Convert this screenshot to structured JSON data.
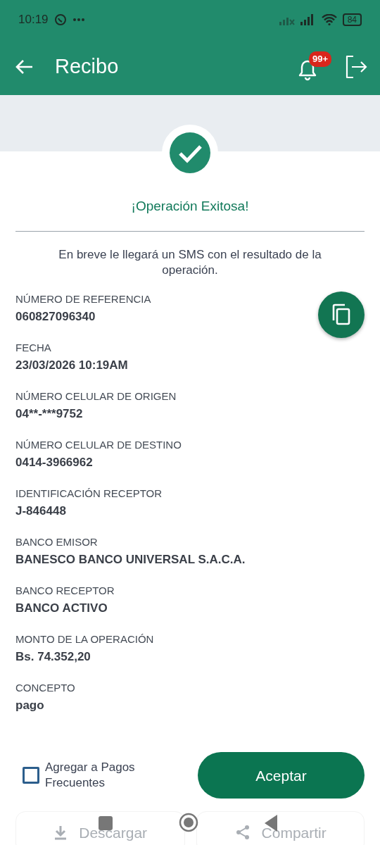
{
  "status_bar": {
    "time": "10:19",
    "battery": "84"
  },
  "app_bar": {
    "title": "Recibo",
    "notification_badge": "99+"
  },
  "result": {
    "title": "¡Operación Exitosa!",
    "message": "En breve le llegará un SMS con el resultado de la operación."
  },
  "fields": [
    {
      "label": "NÚMERO DE REFERENCIA",
      "value": "060827096340"
    },
    {
      "label": "FECHA",
      "value": "23/03/2026 10:19AM"
    },
    {
      "label": "NÚMERO CELULAR DE ORIGEN",
      "value": "04**-***9752"
    },
    {
      "label": "NÚMERO CELULAR DE DESTINO",
      "value": "0414-3966962"
    },
    {
      "label": "IDENTIFICACIÓN RECEPTOR",
      "value": "J-846448"
    },
    {
      "label": "BANCO EMISOR",
      "value": "BANESCO BANCO UNIVERSAL S.A.C.A."
    },
    {
      "label": "BANCO RECEPTOR",
      "value": "BANCO ACTIVO"
    },
    {
      "label": "MONTO DE LA OPERACIÓN",
      "value": "Bs. 74.352,20"
    },
    {
      "label": "CONCEPTO",
      "value": "pago"
    }
  ],
  "frequent_payment": {
    "label": "Agregar a Pagos Frecuentes",
    "checked": false
  },
  "accept_button": "Aceptar",
  "bottom_actions": [
    "Descargar",
    "Compartir"
  ]
}
